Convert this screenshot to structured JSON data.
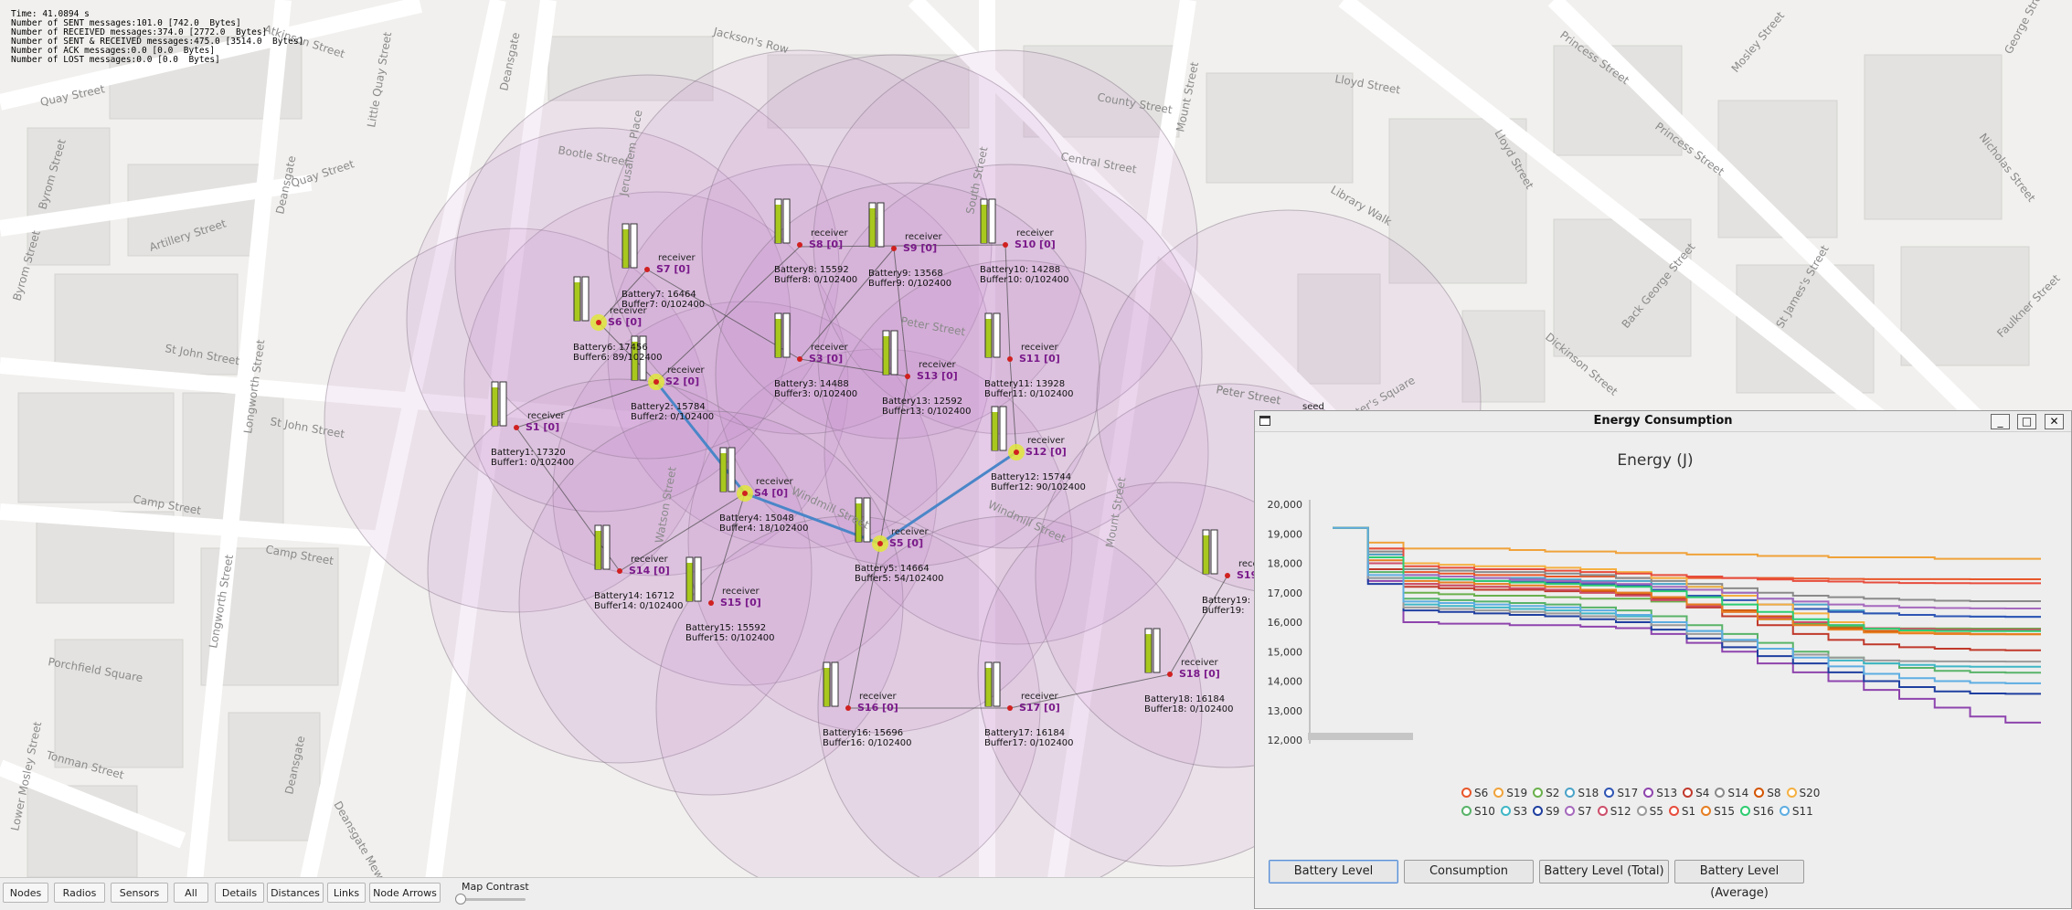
{
  "stats": {
    "time": "Time: 41.0894 s",
    "sent": "Number of SENT messages:101.0 [742.0  Bytes]",
    "received": "Number of RECEIVED messages:374.0 [2772.0  Bytes]",
    "sent_received": "Number of SENT & RECEIVED messages:475.0 [3514.0  Bytes]",
    "ack": "Number of ACK messages:0.0 [0.0  Bytes]",
    "lost": "Number of LOST messages:0.0 [0.0  Bytes]"
  },
  "streets": [
    "Atkinson Street",
    "Jackson's Row",
    "Deansgate",
    "Quay Street",
    "Little Quay Street",
    "Quay Street",
    "Byrom Street",
    "Artillery Street",
    "Byrom Street",
    "Bootle Street",
    "Jerusalem Place",
    "Lloyd Street",
    "County Street",
    "Central Street",
    "South Street",
    "Mount Street",
    "Princess Street",
    "Princess Street",
    "Mosley Street",
    "Nicholas Street",
    "George Street",
    "Lloyd Street",
    "Library Walk",
    "Back George Street",
    "Dickinson Street",
    "St James's Street",
    "Faulkner Street",
    "Peter Street",
    "Peter Street",
    "St John Street",
    "St John Street",
    "Longworth Street",
    "Camp Street",
    "Camp Street",
    "Windmill Street",
    "Watson Street",
    "Mount Street",
    "Porchfield Square",
    "Longworth Street",
    "Deansgate",
    "Deansgate Mews",
    "Tonman Street",
    "Lower Mosley Street",
    "St Peter's Square",
    "Windmill Street",
    "Peter Street",
    "Deansgate"
  ],
  "nodes": [
    {
      "id": "S1",
      "label": "S1 [0]",
      "receiver": "receiver",
      "battery": "Battery1: 17320",
      "buffer": "Buffer1: 0/102400"
    },
    {
      "id": "S2",
      "label": "S2 [0]",
      "receiver": "receiver",
      "battery": "Battery2: 15784",
      "buffer": "Buffer2: 0/102400"
    },
    {
      "id": "S3",
      "label": "S3 [0]",
      "receiver": "receiver",
      "battery": "Battery3: 14488",
      "buffer": "Buffer3: 0/102400"
    },
    {
      "id": "S4",
      "label": "S4 [0]",
      "receiver": "receiver",
      "battery": "Battery4: 15048",
      "buffer": "Buffer4: 18/102400"
    },
    {
      "id": "S5",
      "label": "S5 [0]",
      "receiver": "receiver",
      "battery": "Battery5: 14664",
      "buffer": "Buffer5: 54/102400"
    },
    {
      "id": "S6",
      "label": "S6 [0]",
      "receiver": "receiver",
      "battery": "Battery6: 17456",
      "buffer": "Buffer6: 89/102400"
    },
    {
      "id": "S7",
      "label": "S7 [0]",
      "receiver": "receiver",
      "battery": "Battery7: 16464",
      "buffer": "Buffer7: 0/102400"
    },
    {
      "id": "S8",
      "label": "S8 [0]",
      "receiver": "receiver",
      "battery": "Battery8: 15592",
      "buffer": "Buffer8: 0/102400"
    },
    {
      "id": "S9",
      "label": "S9 [0]",
      "receiver": "receiver",
      "battery": "Battery9: 13568",
      "buffer": "Buffer9: 0/102400"
    },
    {
      "id": "S10",
      "label": "S10 [0]",
      "receiver": "receiver",
      "battery": "Battery10: 14288",
      "buffer": "Buffer10: 0/102400"
    },
    {
      "id": "S11",
      "label": "S11 [0]",
      "receiver": "receiver",
      "battery": "Battery11: 13928",
      "buffer": "Buffer11: 0/102400"
    },
    {
      "id": "S12",
      "label": "S12 [0]",
      "receiver": "receiver",
      "battery": "Battery12: 15744",
      "buffer": "Buffer12: 90/102400"
    },
    {
      "id": "S13",
      "label": "S13 [0]",
      "receiver": "receiver",
      "battery": "Battery13: 12592",
      "buffer": "Buffer13: 0/102400"
    },
    {
      "id": "S14",
      "label": "S14 [0]",
      "receiver": "receiver",
      "battery": "Battery14: 16712",
      "buffer": "Buffer14: 0/102400"
    },
    {
      "id": "S15",
      "label": "S15 [0]",
      "receiver": "receiver",
      "battery": "Battery15: 15592",
      "buffer": "Buffer15: 0/102400"
    },
    {
      "id": "S16",
      "label": "S16 [0]",
      "receiver": "receiver",
      "battery": "Battery16: 15696",
      "buffer": "Buffer16: 0/102400"
    },
    {
      "id": "S17",
      "label": "S17 [0]",
      "receiver": "receiver",
      "battery": "Battery17: 16184",
      "buffer": "Buffer17: 0/102400"
    },
    {
      "id": "S18",
      "label": "S18 [0]",
      "receiver": "receiver",
      "battery": "Battery18: 16184",
      "buffer": "Buffer18: 0/102400"
    },
    {
      "id": "S19",
      "label": "S19 [0]",
      "receiver": "receiver",
      "battery": "Battery19:",
      "buffer": "Buffer19:"
    }
  ],
  "seed_label": "seed",
  "toolbar": {
    "buttons": [
      "Nodes",
      "Radios",
      "Sensors",
      "All",
      "Details",
      "Distances",
      "Links",
      "Node Arrows"
    ],
    "contrast_label": "Map Contrast"
  },
  "energy_window": {
    "title": "Energy Consumption",
    "controls": {
      "minimize": "_",
      "maximize": "□",
      "close": "✕"
    },
    "tabs": [
      "Battery Level",
      "Consumption",
      "Battery Level (Total)",
      "Battery Level (Average)"
    ],
    "selected_tab": "Battery Level"
  },
  "chart_data": {
    "type": "line",
    "title": "Energy (J)",
    "ylim": [
      12000,
      20000
    ],
    "yticks": [
      "20,000",
      "19,000",
      "18,000",
      "17,000",
      "16,000",
      "15,000",
      "14,000",
      "13,000",
      "12,000"
    ],
    "x": [
      0,
      1,
      2,
      3,
      4,
      5,
      6,
      7,
      8,
      9,
      10,
      11,
      12,
      13,
      14,
      15,
      16,
      17,
      18,
      19,
      20
    ],
    "series": [
      {
        "name": "S6",
        "color": "#e8572a",
        "values": [
          19200,
          18300,
          17700,
          17650,
          17600,
          17600,
          17550,
          17550,
          17500,
          17500,
          17500,
          17500,
          17500,
          17480,
          17470,
          17460,
          17460,
          17460,
          17456,
          17456,
          17456
        ]
      },
      {
        "name": "S19",
        "color": "#f0a23a",
        "values": [
          19200,
          18700,
          18500,
          18500,
          18500,
          18450,
          18400,
          18400,
          18350,
          18350,
          18300,
          18300,
          18250,
          18250,
          18200,
          18200,
          18200,
          18150,
          18150,
          18150,
          18150
        ]
      },
      {
        "name": "S2",
        "color": "#6ab04c",
        "values": [
          19200,
          18000,
          17000,
          16950,
          16900,
          16900,
          16850,
          16800,
          16800,
          16700,
          16600,
          16400,
          16100,
          15950,
          15850,
          15800,
          15790,
          15785,
          15784,
          15784,
          15784
        ]
      },
      {
        "name": "S18",
        "color": "#4aa3c8",
        "values": [
          19200,
          18300,
          17600,
          17550,
          17500,
          17500,
          17450,
          17400,
          17400,
          17300,
          17200,
          17000,
          16800,
          16600,
          16400,
          16300,
          16250,
          16200,
          16190,
          16184,
          16184
        ]
      },
      {
        "name": "S17",
        "color": "#2f55b4",
        "values": [
          19200,
          18200,
          17500,
          17450,
          17400,
          17380,
          17350,
          17300,
          17250,
          17100,
          16900,
          16750,
          16600,
          16450,
          16350,
          16300,
          16250,
          16200,
          16190,
          16184,
          16184
        ]
      },
      {
        "name": "S13",
        "color": "#8e44ad",
        "values": [
          19200,
          17400,
          16000,
          15950,
          15950,
          15900,
          15900,
          15850,
          15800,
          15600,
          15300,
          15000,
          14600,
          14300,
          14000,
          13700,
          13400,
          13100,
          12800,
          12592,
          12592
        ]
      },
      {
        "name": "S4",
        "color": "#c0392b",
        "values": [
          19200,
          17800,
          17200,
          17150,
          17100,
          17100,
          17050,
          17000,
          16950,
          16800,
          16500,
          16200,
          15900,
          15600,
          15400,
          15250,
          15150,
          15100,
          15060,
          15048,
          15048
        ]
      },
      {
        "name": "S14",
        "color": "#8a8a8a",
        "values": [
          19200,
          18400,
          17800,
          17750,
          17700,
          17700,
          17650,
          17600,
          17500,
          17400,
          17300,
          17150,
          17000,
          16900,
          16850,
          16800,
          16760,
          16730,
          16715,
          16712,
          16712
        ]
      },
      {
        "name": "S8",
        "color": "#d35400",
        "values": [
          19200,
          18000,
          17300,
          17250,
          17200,
          17150,
          17100,
          17050,
          17000,
          16850,
          16600,
          16400,
          16200,
          16000,
          15800,
          15700,
          15650,
          15620,
          15600,
          15592,
          15592
        ]
      },
      {
        "name": "S20",
        "color": "#f5b041",
        "values": [
          19200,
          18500,
          18000,
          17950,
          17900,
          17900,
          17850,
          17800,
          17700,
          17500,
          17200,
          16900,
          16600,
          16300,
          16000,
          15800,
          15650,
          15600,
          15590,
          15590,
          15590
        ]
      },
      {
        "name": "S10",
        "color": "#58b368",
        "values": [
          19200,
          17700,
          16800,
          16750,
          16700,
          16650,
          16600,
          16500,
          16400,
          16200,
          15900,
          15600,
          15300,
          15000,
          14800,
          14600,
          14450,
          14350,
          14300,
          14288,
          14288
        ]
      },
      {
        "name": "S3",
        "color": "#3fb6c6",
        "values": [
          19200,
          17500,
          16600,
          16550,
          16500,
          16450,
          16400,
          16300,
          16200,
          16000,
          15700,
          15400,
          15100,
          14900,
          14700,
          14600,
          14550,
          14500,
          14490,
          14488,
          14488
        ]
      },
      {
        "name": "S9",
        "color": "#1f3fa0",
        "values": [
          19200,
          17300,
          16400,
          16350,
          16300,
          16250,
          16200,
          16100,
          16000,
          15750,
          15450,
          15150,
          14850,
          14600,
          14300,
          14000,
          13800,
          13650,
          13580,
          13568,
          13568
        ]
      },
      {
        "name": "S7",
        "color": "#a569bd",
        "values": [
          19200,
          18200,
          17600,
          17550,
          17500,
          17450,
          17400,
          17350,
          17300,
          17200,
          17100,
          17000,
          16800,
          16700,
          16600,
          16550,
          16500,
          16480,
          16470,
          16464,
          16464
        ]
      },
      {
        "name": "S12",
        "color": "#cd4f6b",
        "values": [
          19200,
          18000,
          17300,
          17250,
          17200,
          17150,
          17100,
          17000,
          16900,
          16750,
          16550,
          16350,
          16150,
          16000,
          15900,
          15800,
          15770,
          15750,
          15746,
          15744,
          15744
        ]
      },
      {
        "name": "S5",
        "color": "#9a9a9a",
        "values": [
          19200,
          17500,
          16500,
          16450,
          16400,
          16350,
          16300,
          16200,
          16100,
          15900,
          15600,
          15350,
          15100,
          14900,
          14800,
          14700,
          14680,
          14670,
          14665,
          14664,
          14664
        ]
      },
      {
        "name": "S1",
        "color": "#e74c3c",
        "values": [
          19200,
          18500,
          17900,
          17850,
          17800,
          17800,
          17750,
          17700,
          17650,
          17600,
          17550,
          17500,
          17450,
          17400,
          17380,
          17350,
          17330,
          17325,
          17320,
          17320,
          17320
        ]
      },
      {
        "name": "S15",
        "color": "#e67e22",
        "values": [
          19200,
          18100,
          17400,
          17350,
          17300,
          17250,
          17200,
          17100,
          17000,
          16850,
          16600,
          16350,
          16100,
          15900,
          15750,
          15650,
          15620,
          15600,
          15594,
          15592,
          15592
        ]
      },
      {
        "name": "S16",
        "color": "#2ecc71",
        "values": [
          19200,
          18200,
          17500,
          17450,
          17400,
          17350,
          17300,
          17250,
          17200,
          17050,
          16850,
          16600,
          16350,
          16100,
          15900,
          15780,
          15720,
          15700,
          15696,
          15696,
          15696
        ]
      },
      {
        "name": "S11",
        "color": "#5dade2",
        "values": [
          19200,
          17600,
          16700,
          16650,
          16600,
          16550,
          16500,
          16400,
          16250,
          16000,
          15700,
          15400,
          15100,
          14800,
          14500,
          14250,
          14100,
          14000,
          13940,
          13928,
          13928
        ]
      }
    ]
  }
}
